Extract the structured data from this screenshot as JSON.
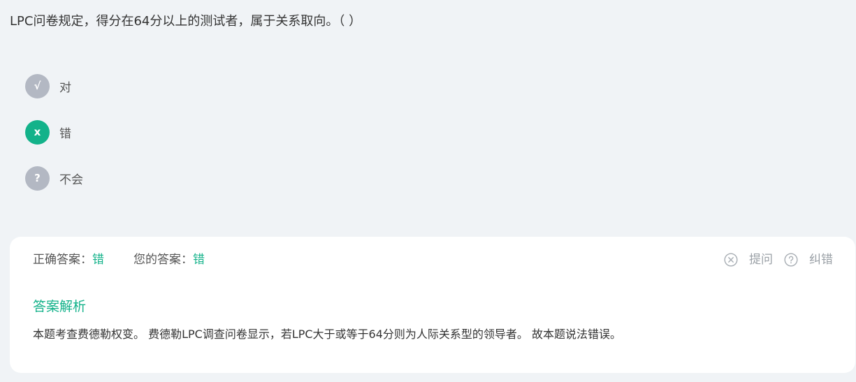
{
  "question": {
    "text": "LPC问卷规定，得分在64分以上的测试者，属于关系取向。（ ）"
  },
  "options": [
    {
      "symbol": "√",
      "label": "对",
      "selected": false
    },
    {
      "symbol": "x",
      "label": "错",
      "selected": true
    },
    {
      "symbol": "?",
      "label": "不会",
      "selected": false
    }
  ],
  "result": {
    "correct_label": "正确答案：",
    "correct_value": "错",
    "your_label": "您的答案：",
    "your_value": "错"
  },
  "actions": {
    "ask_label": "提问",
    "ask_icon": "close-circle-icon",
    "report_label": "纠错",
    "report_icon": "question-circle-icon"
  },
  "analysis": {
    "title": "答案解析",
    "text": "本题考查费德勒权变。 费德勒LPC调查问卷显示，若LPC大于或等于64分则为人际关系型的领导者。 故本题说法错误。"
  },
  "colors": {
    "accent": "#13b28a",
    "badge_inactive": "#b3b8c3",
    "background": "#f0f3f6"
  }
}
